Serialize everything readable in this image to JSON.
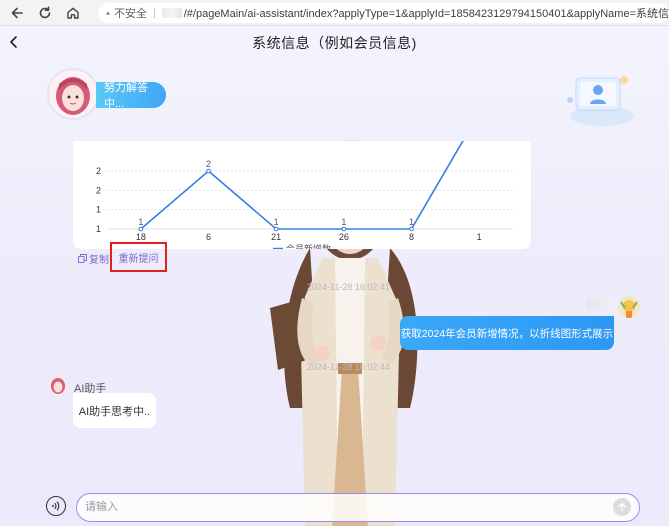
{
  "browser": {
    "insecure_label": "不安全",
    "url": "/#/pageMain/ai-assistant/index?applyType=1&applyId=1858423129794150401&applyName=系统信"
  },
  "header": {
    "title": "系统信息（例如会员信息)"
  },
  "assistant": {
    "status": "努力解答中..."
  },
  "chart_data": {
    "type": "line",
    "categories": [
      "18",
      "6",
      "21",
      "26",
      "8",
      "1"
    ],
    "series": [
      {
        "name": "会员新增数",
        "values": [
          1,
          2,
          1,
          1,
          1,
          3
        ]
      }
    ],
    "point_labels": [
      "1",
      "2",
      "1",
      "1",
      "1",
      ""
    ],
    "y_tick_labels": [
      "1",
      "1",
      "2",
      "2"
    ],
    "ylim": [
      1,
      2.5
    ],
    "grid": true,
    "legend": "bottom",
    "color": "#2f80e6"
  },
  "actions": {
    "copy": "复制",
    "regenerate": "重新提问"
  },
  "timestamps": {
    "t1": "2024-11-28 16:02:41",
    "t2": "2024-11-28 16:02:44"
  },
  "user_message": {
    "text": "获取2024年会员新增情况，以折线图形式展示"
  },
  "ai_reply": {
    "name": "AI助手",
    "text": "AI助手思考中.."
  },
  "input": {
    "placeholder": "请输入"
  }
}
